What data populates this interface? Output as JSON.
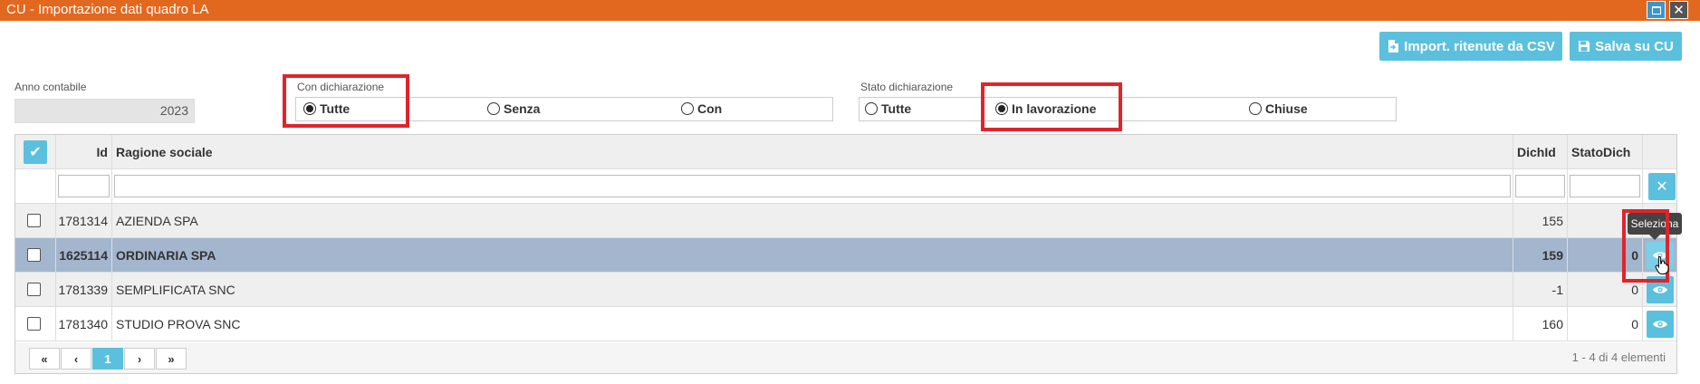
{
  "window": {
    "title": "CU - Importazione dati quadro LA",
    "close_glyph": "✕"
  },
  "toolbar": {
    "import_csv_label": "Import. ritenute da CSV",
    "import_csv_icon": "file-import-icon",
    "save_label": "Salva su CU",
    "save_icon": "floppy-disk-icon"
  },
  "filters": {
    "year": {
      "label": "Anno contabile",
      "value": "2023"
    },
    "con_dichiarazione": {
      "label": "Con dichiarazione",
      "options": [
        {
          "label": "Tutte",
          "checked": true
        },
        {
          "label": "Senza",
          "checked": false
        },
        {
          "label": "Con",
          "checked": false
        }
      ]
    },
    "stato_dichiarazione": {
      "label": "Stato dichiarazione",
      "options": [
        {
          "label": "Tutte",
          "checked": false
        },
        {
          "label": "In lavorazione",
          "checked": true
        },
        {
          "label": "Chiuse",
          "checked": false
        }
      ]
    }
  },
  "grid": {
    "columns": {
      "select_all_glyph": "✔",
      "id": "Id",
      "ragione": "Ragione sociale",
      "dichid": "DichId",
      "statodich": "StatoDich"
    },
    "clear_filter_glyph": "✕",
    "rows": [
      {
        "id": "1781314",
        "ragione": "AZIENDA SPA",
        "dichid": "155",
        "statodich": "",
        "selected": false
      },
      {
        "id": "1625114",
        "ragione": "ORDINARIA SPA",
        "dichid": "159",
        "statodich": "0",
        "selected": true
      },
      {
        "id": "1781339",
        "ragione": "SEMPLIFICATA SNC",
        "dichid": "-1",
        "statodich": "0",
        "selected": false
      },
      {
        "id": "1781340",
        "ragione": "STUDIO PROVA SNC",
        "dichid": "160",
        "statodich": "0",
        "selected": false
      }
    ],
    "pager": {
      "first": "«",
      "prev": "‹",
      "current": "1",
      "next": "›",
      "last": "»",
      "info": "1 - 4 di 4 elementi"
    },
    "tooltip": "Seleziona"
  },
  "colors": {
    "titlebar": "#E3681F",
    "accent": "#5BC0DE",
    "selected_row": "#A3B6CE",
    "highlight": "#E0242B"
  }
}
